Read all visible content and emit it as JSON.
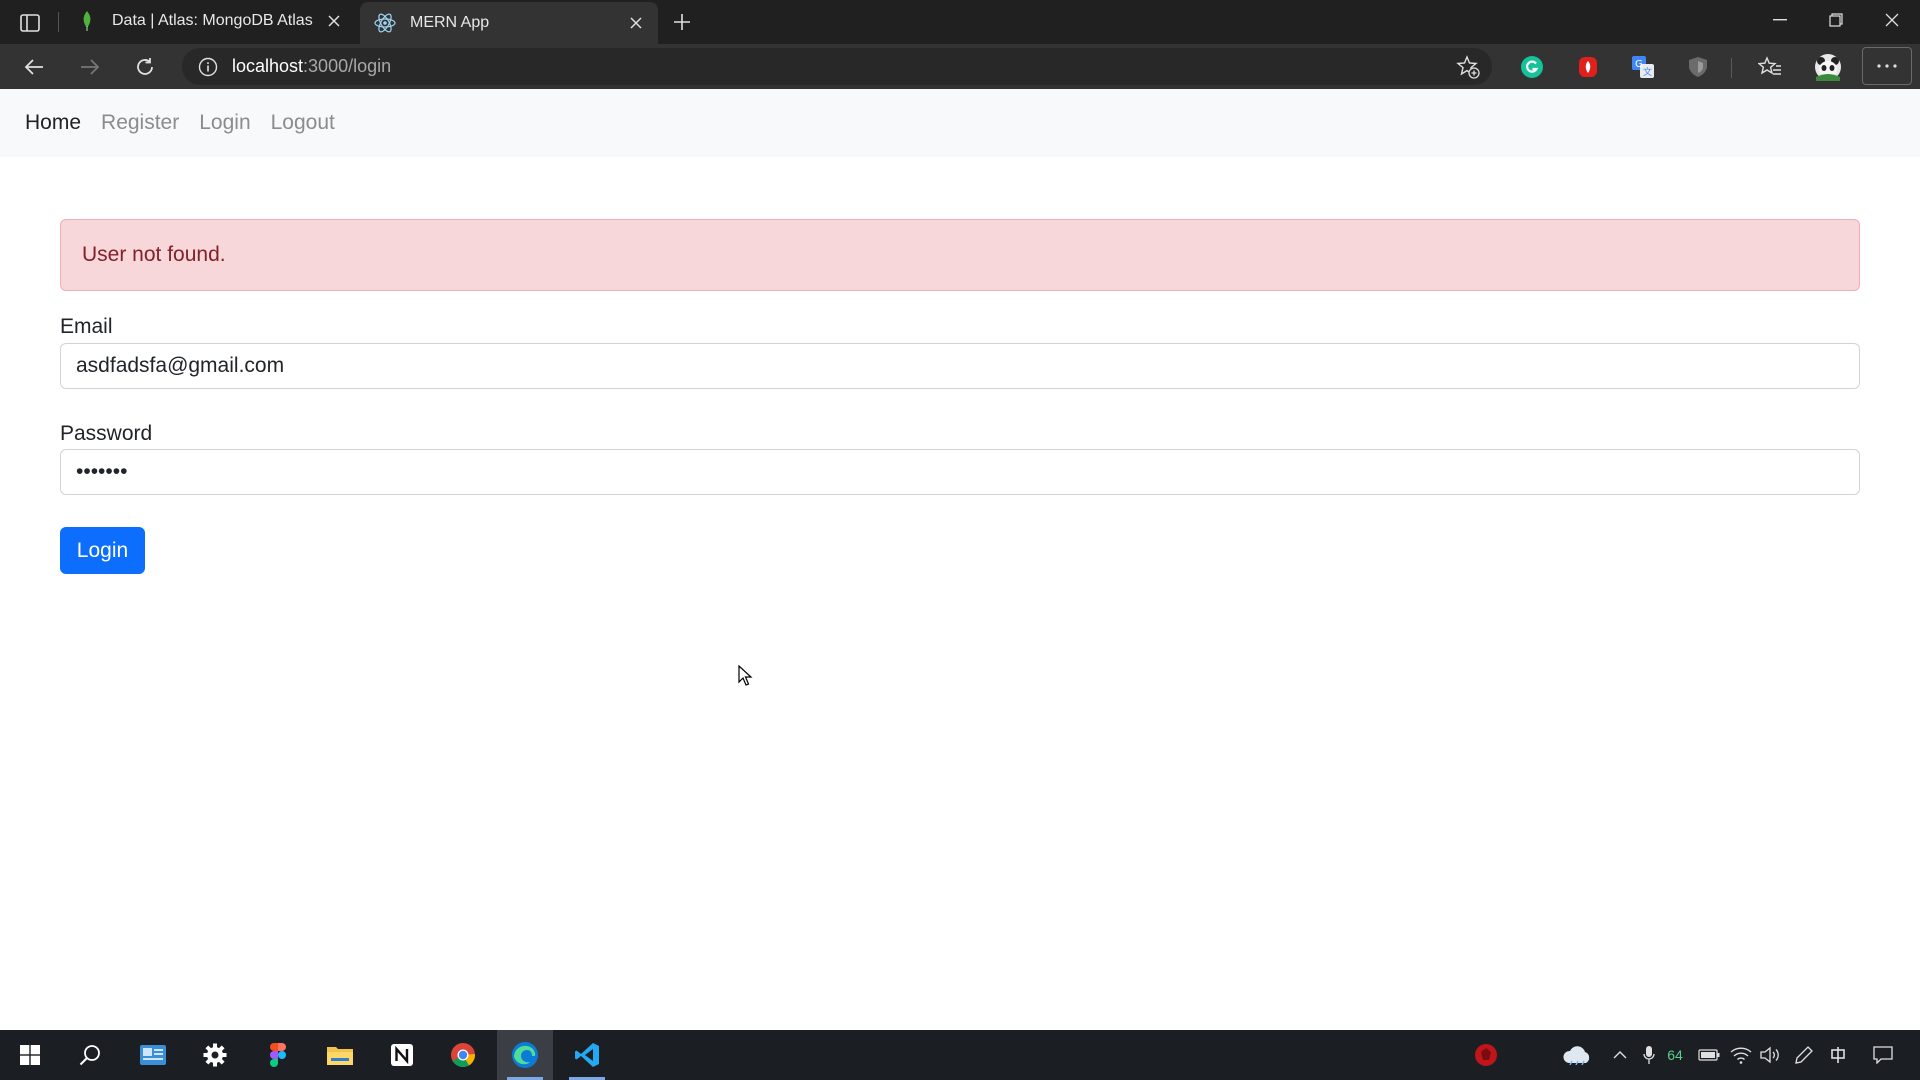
{
  "browser": {
    "tabs": [
      {
        "title": "Data | Atlas: MongoDB Atlas",
        "icon": "mongodb-leaf-icon",
        "active": false
      },
      {
        "title": "MERN App",
        "icon": "react-icon",
        "active": true
      }
    ],
    "url_host": "localhost",
    "url_path": ":3000/login",
    "extensions": [
      "grammarly-icon",
      "extension-red-icon",
      "translate-icon",
      "shield-icon"
    ]
  },
  "navbar": {
    "brand": "Home",
    "links": [
      "Register",
      "Login",
      "Logout"
    ]
  },
  "alert": {
    "message": "User not found."
  },
  "form": {
    "email_label": "Email",
    "email_value": "asdfadsfa@gmail.com",
    "password_label": "Password",
    "password_value": "fakepwd",
    "submit_label": "Login"
  },
  "taskbar": {
    "apps": [
      "windows-start-icon",
      "search-icon",
      "news-icon",
      "settings-icon",
      "figma-icon",
      "file-explorer-icon",
      "notion-icon",
      "chrome-icon",
      "edge-icon",
      "vscode-icon"
    ],
    "tray_number": "64"
  },
  "colors": {
    "primary": "#0d6efd",
    "alert_bg": "#f8d7da",
    "alert_text": "#842029"
  }
}
